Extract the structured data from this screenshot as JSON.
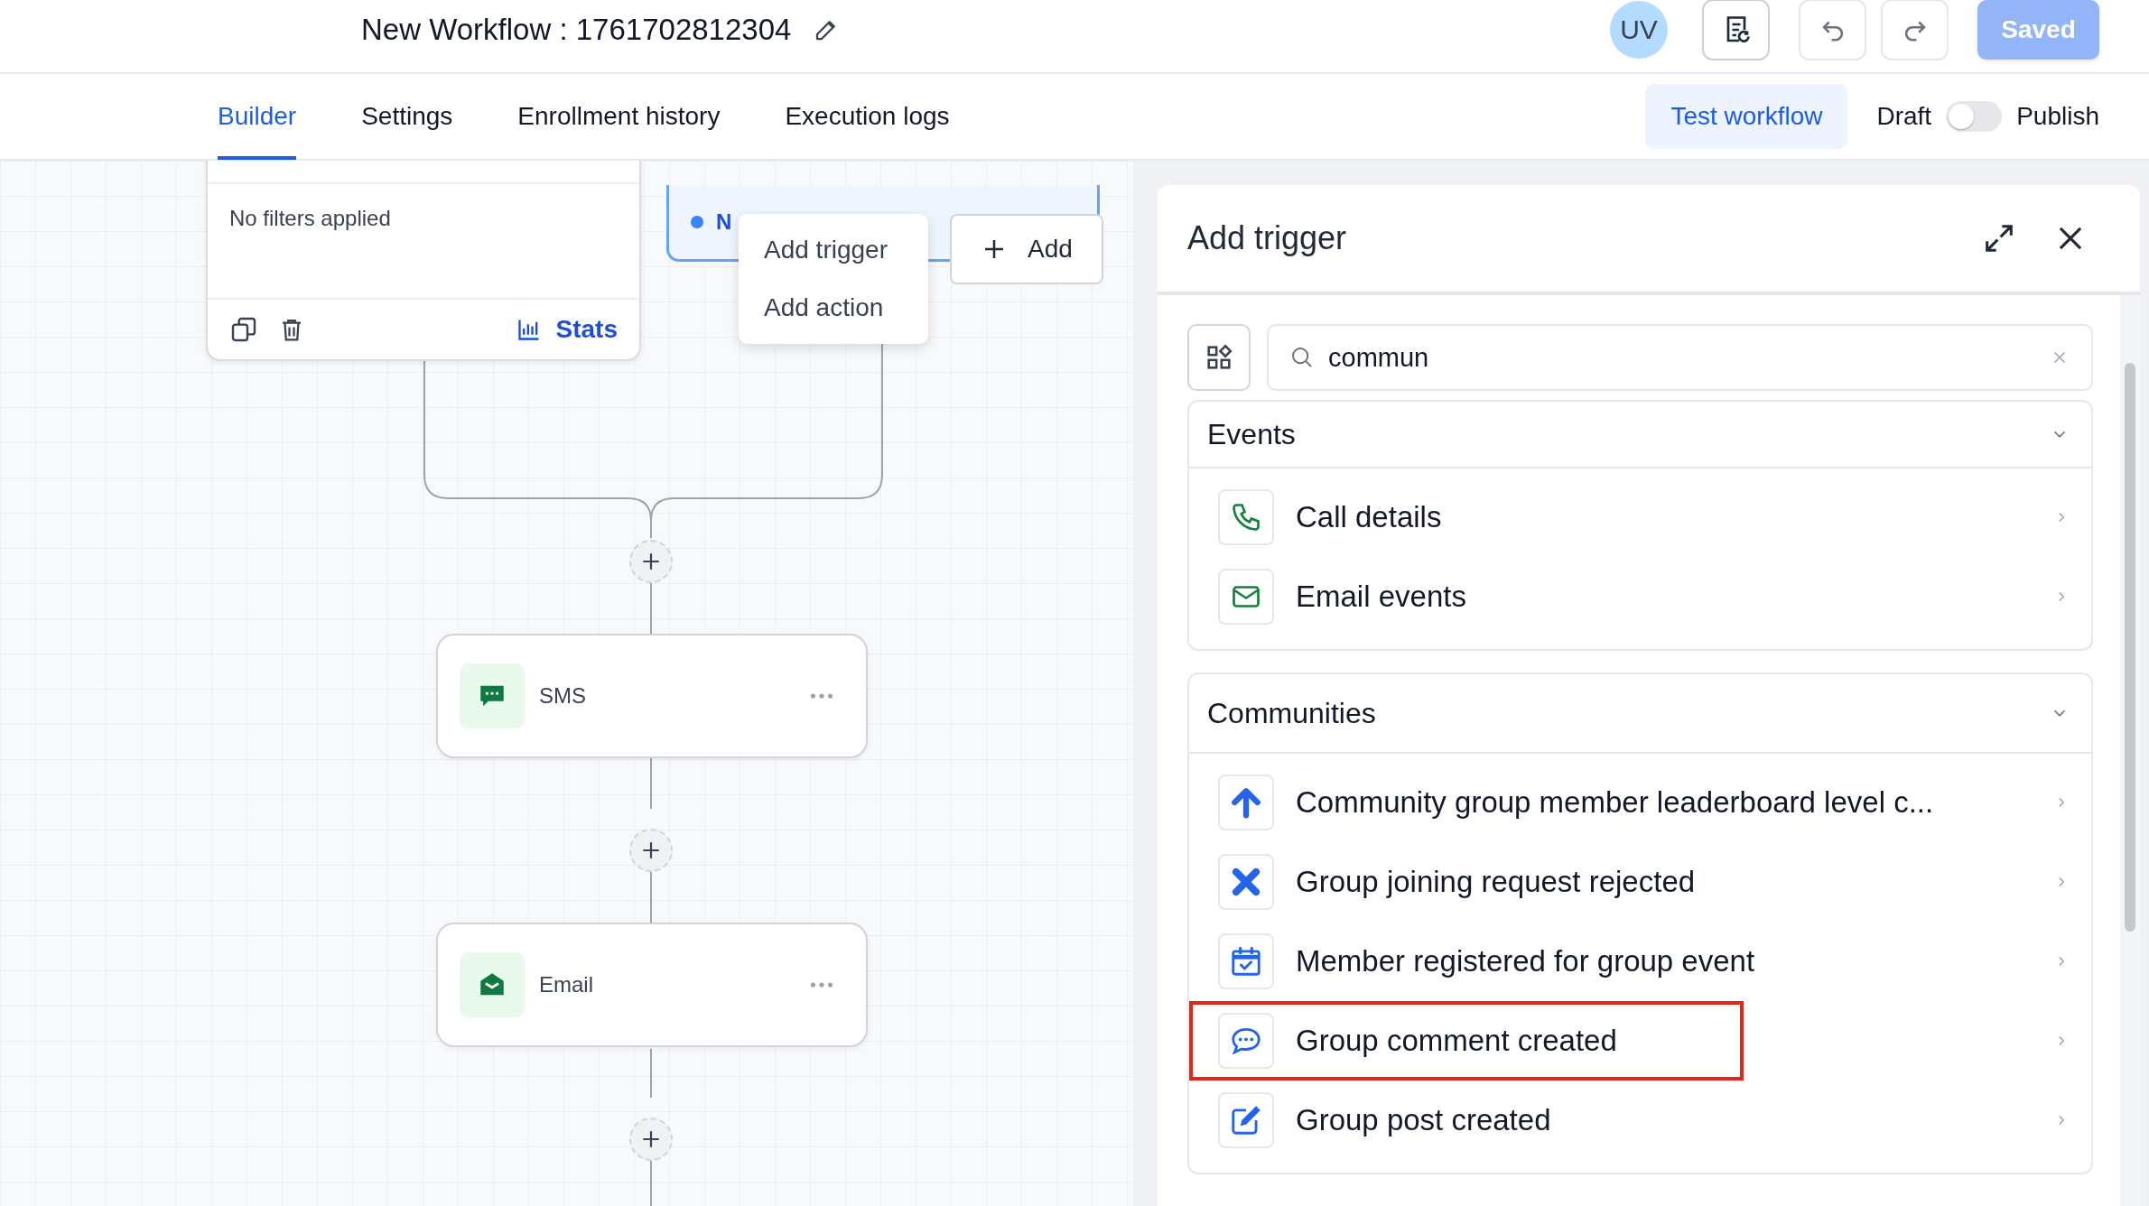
{
  "header": {
    "title": "New Workflow : 1761702812304",
    "avatar": "UV",
    "save_button": "Saved"
  },
  "tabs": [
    {
      "label": "Builder",
      "selected": true
    },
    {
      "label": "Settings",
      "selected": false
    },
    {
      "label": "Enrollment history",
      "selected": false
    },
    {
      "label": "Execution logs",
      "selected": false
    }
  ],
  "test_button": "Test workflow",
  "publish_toggle": {
    "off_label": "Draft",
    "on_label": "Publish",
    "on": false
  },
  "canvas": {
    "filter_card": {
      "text": "No filters applied",
      "stats": "Stats"
    },
    "trigger_card": {
      "label": "N"
    },
    "menu": [
      "Add trigger",
      "Add action"
    ],
    "add_button": "Add",
    "actions": [
      {
        "label": "SMS",
        "kind": "sms"
      },
      {
        "label": "Email",
        "kind": "email"
      }
    ]
  },
  "panel": {
    "title": "Add trigger",
    "search": {
      "value": "commun"
    },
    "sections": [
      {
        "title": "Events",
        "expanded": true,
        "items": [
          {
            "label": "Call details",
            "kind": "phone",
            "highlighted": false
          },
          {
            "label": "Email events",
            "kind": "mail",
            "highlighted": false
          }
        ]
      },
      {
        "title": "Communities",
        "expanded": true,
        "items": [
          {
            "label": "Community group member leaderboard level c...",
            "kind": "arrow-up",
            "highlighted": false
          },
          {
            "label": "Group joining request rejected",
            "kind": "x",
            "highlighted": false
          },
          {
            "label": "Member registered for group event",
            "kind": "calendar",
            "highlighted": false
          },
          {
            "label": "Group comment created",
            "kind": "comment",
            "highlighted": true
          },
          {
            "label": "Group post created",
            "kind": "edit",
            "highlighted": false
          }
        ]
      }
    ]
  }
}
